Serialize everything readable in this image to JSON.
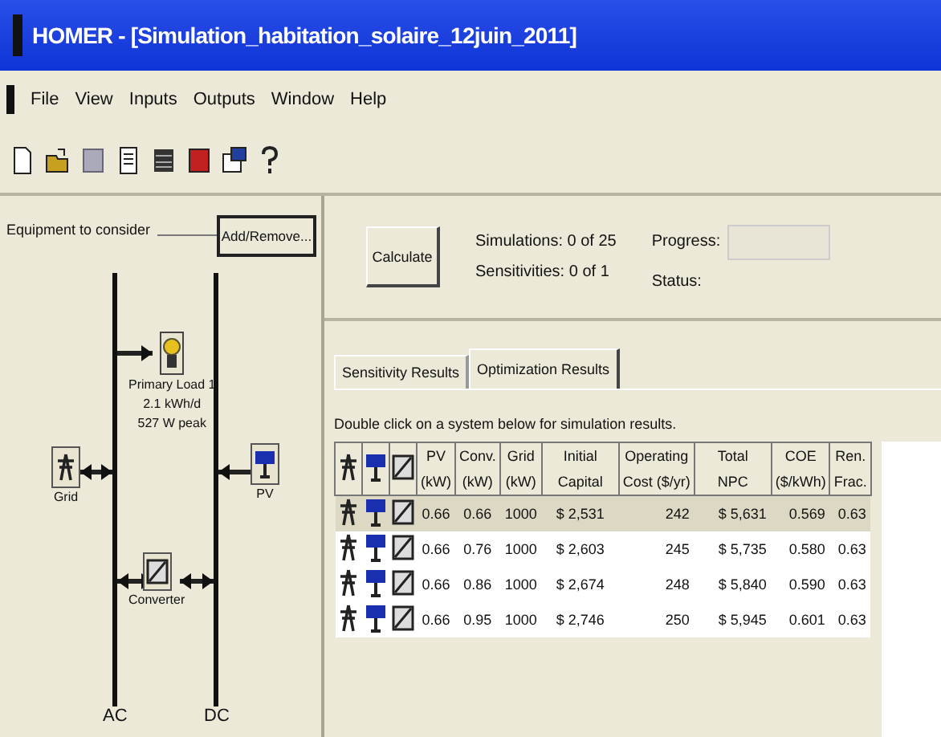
{
  "window": {
    "title": "HOMER - [Simulation_habitation_solaire_12juin_2011]"
  },
  "menu": [
    "File",
    "View",
    "Inputs",
    "Outputs",
    "Window",
    "Help"
  ],
  "equipment": {
    "heading": "Equipment to consider",
    "add_remove": "Add/Remove...",
    "buses": [
      "AC",
      "DC"
    ],
    "components": [
      {
        "kind": "load",
        "lines": [
          "Primary Load 1",
          "2.1 kWh/d",
          "527 W peak"
        ]
      },
      {
        "kind": "grid",
        "lines": [
          "Grid"
        ]
      },
      {
        "kind": "pv",
        "lines": [
          "PV"
        ]
      },
      {
        "kind": "converter",
        "lines": [
          "Converter"
        ]
      }
    ]
  },
  "calculate": {
    "button": "Calculate",
    "simulations": "Simulations: 0 of 25",
    "sensitivities": "Sensitivities: 0 of 1",
    "progress_label": "Progress:",
    "progress": {
      "level": 0
    },
    "status_label": "Status:"
  },
  "tabs": [
    {
      "label": "Sensitivity Results",
      "selected": false
    },
    {
      "label": "Optimization Results",
      "selected": true
    }
  ],
  "hint": "Double click on a system below for simulation results.",
  "table": {
    "header_rows": [
      [
        "PV",
        "Conv.",
        "Grid",
        "Initial",
        "Operating",
        "Total",
        "COE",
        "Ren."
      ],
      [
        "(kW)",
        "(kW)",
        "(kW)",
        "Capital",
        "Cost ($/yr)",
        "NPC",
        "($/kWh)",
        "Frac."
      ]
    ],
    "rows": [
      {
        "selected": true,
        "cells": [
          "0.66",
          "0.66",
          "1000",
          "$ 2,531",
          "242",
          "$ 5,631",
          "0.569",
          "0.63"
        ]
      },
      {
        "selected": false,
        "cells": [
          "0.66",
          "0.76",
          "1000",
          "$ 2,603",
          "245",
          "$ 5,735",
          "0.580",
          "0.63"
        ]
      },
      {
        "selected": false,
        "cells": [
          "0.66",
          "0.86",
          "1000",
          "$ 2,674",
          "248",
          "$ 5,840",
          "0.590",
          "0.63"
        ]
      },
      {
        "selected": false,
        "cells": [
          "0.66",
          "0.95",
          "1000",
          "$ 2,746",
          "250",
          "$ 5,945",
          "0.601",
          "0.63"
        ]
      }
    ]
  }
}
